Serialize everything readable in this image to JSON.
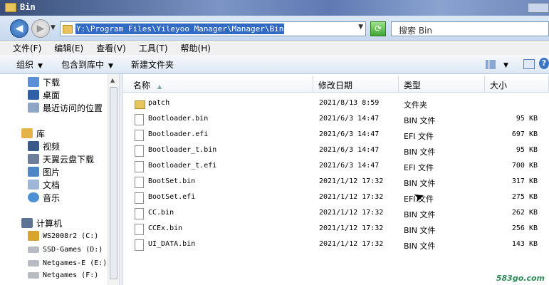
{
  "window": {
    "title": "Bin"
  },
  "address": {
    "path": "Y:\\Program Files\\Yileyoo Manager\\Manager\\Bin",
    "search_placeholder": "搜索 Bin"
  },
  "menu": [
    "文件(F)",
    "编辑(E)",
    "查看(V)",
    "工具(T)",
    "帮助(H)"
  ],
  "toolbar": {
    "organize": "组织",
    "include_in_library": "包含到库中",
    "new_folder": "新建文件夹"
  },
  "nav": {
    "favorites": [
      "下载",
      "桌面",
      "最近访问的位置"
    ],
    "library_label": "库",
    "libraries": [
      "视频",
      "天翼云盘下载",
      "图片",
      "文档",
      "音乐"
    ],
    "computer_label": "计算机",
    "drives": [
      "WS2008r2 (C:)",
      "SSD-Games (D:)",
      "Netgames-E (E:)",
      "Netgames (F:)"
    ]
  },
  "columns": {
    "name": "名称",
    "date": "修改日期",
    "type": "类型",
    "size": "大小"
  },
  "files": [
    {
      "name": "patch",
      "date": "2021/8/13 8:59",
      "type": "文件夹",
      "size": "",
      "icon": "folder-icon"
    },
    {
      "name": "Bootloader.bin",
      "date": "2021/6/3 14:47",
      "type": "BIN 文件",
      "size": "95 KB",
      "icon": "file-icon"
    },
    {
      "name": "Bootloader.efi",
      "date": "2021/6/3 14:47",
      "type": "EFI 文件",
      "size": "697 KB",
      "icon": "file-icon"
    },
    {
      "name": "Bootloader_t.bin",
      "date": "2021/6/3 14:47",
      "type": "BIN 文件",
      "size": "95 KB",
      "icon": "file-icon"
    },
    {
      "name": "Bootloader_t.efi",
      "date": "2021/6/3 14:47",
      "type": "EFI 文件",
      "size": "700 KB",
      "icon": "file-icon"
    },
    {
      "name": "BootSet.bin",
      "date": "2021/1/12 17:32",
      "type": "BIN 文件",
      "size": "317 KB",
      "icon": "file-icon"
    },
    {
      "name": "BootSet.efi",
      "date": "2021/1/12 17:32",
      "type": "EFI 文件",
      "size": "275 KB",
      "icon": "file-icon"
    },
    {
      "name": "CC.bin",
      "date": "2021/1/12 17:32",
      "type": "BIN 文件",
      "size": "262 KB",
      "icon": "file-icon"
    },
    {
      "name": "CCEx.bin",
      "date": "2021/1/12 17:32",
      "type": "BIN 文件",
      "size": "256 KB",
      "icon": "file-icon"
    },
    {
      "name": "UI_DATA.bin",
      "date": "2021/1/12 17:32",
      "type": "BIN 文件",
      "size": "143 KB",
      "icon": "file-icon"
    }
  ],
  "watermark": "583go.com"
}
